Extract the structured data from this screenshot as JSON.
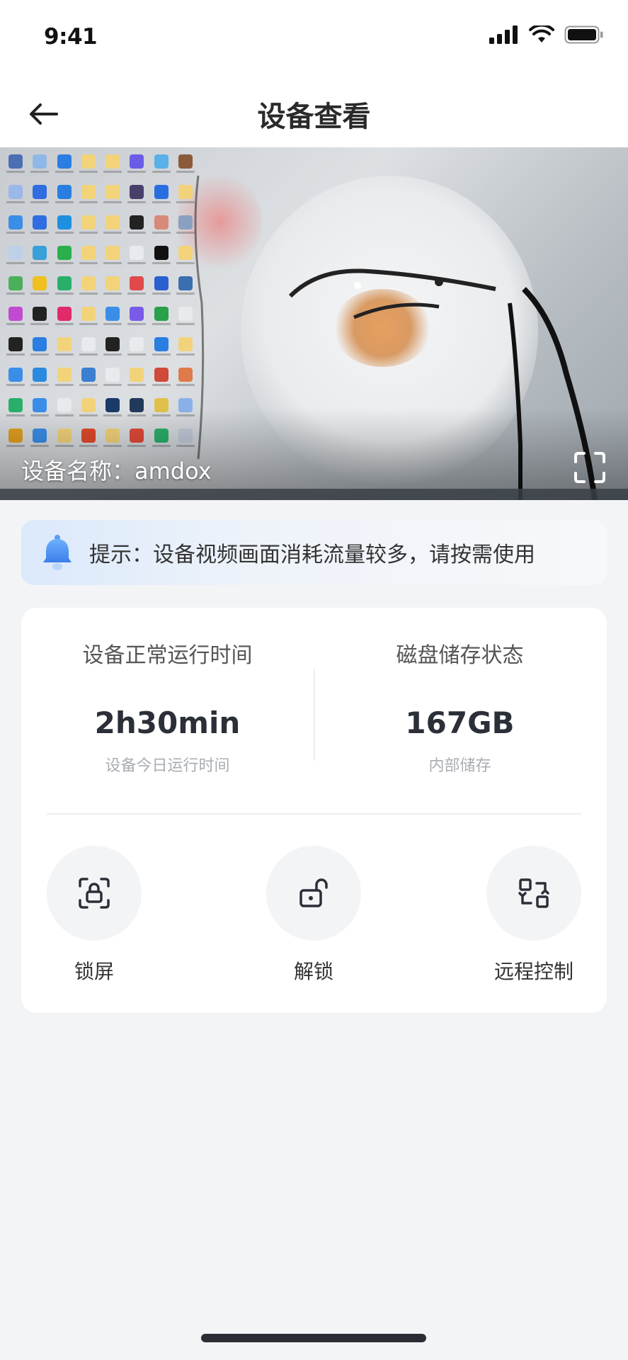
{
  "status_bar": {
    "time": "9:41",
    "icons": [
      "signal-icon",
      "wifi-icon",
      "battery-icon"
    ]
  },
  "nav": {
    "title": "设备查看",
    "back_icon": "arrow-left-icon"
  },
  "video": {
    "device_name": "设备名称：amdox",
    "fullscreen_icon": "fullscreen-icon"
  },
  "notice": {
    "icon": "bell-icon",
    "text": "提示：设备视频画面消耗流量较多，请按需使用"
  },
  "stats": {
    "uptime": {
      "title": "设备正常运行时间",
      "value": "2h30min",
      "sub": "设备今日运行时间"
    },
    "disk": {
      "title": "磁盘储存状态",
      "value": "167GB",
      "sub": "内部储存"
    }
  },
  "actions": [
    {
      "label": "锁屏",
      "icon": "lock-screen-icon"
    },
    {
      "label": "解锁",
      "icon": "unlock-icon"
    },
    {
      "label": "远程控制",
      "icon": "remote-control-icon"
    }
  ],
  "colors": {
    "page_bg": "#f3f4f6",
    "card_bg": "#ffffff",
    "notice_accent": "#4a90f0",
    "icon_dark": "#2b2f38"
  }
}
